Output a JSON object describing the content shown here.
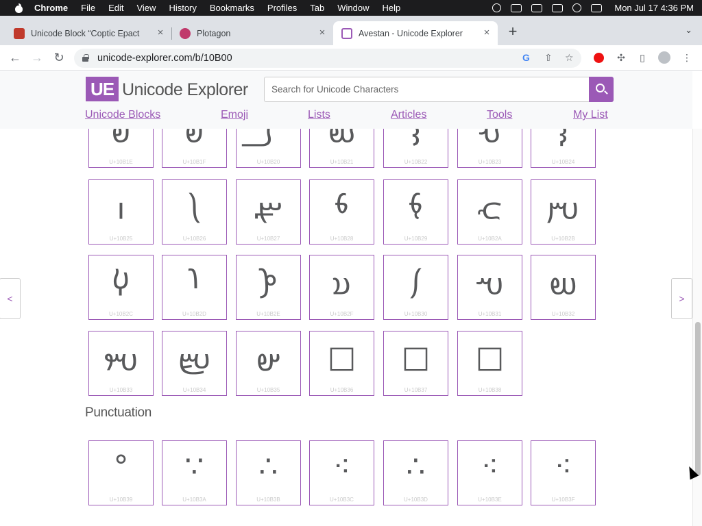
{
  "menubar": {
    "app_name": "Chrome",
    "items": [
      "File",
      "Edit",
      "View",
      "History",
      "Bookmarks",
      "Profiles",
      "Tab",
      "Window",
      "Help"
    ],
    "clock": "Mon Jul 17  4:36 PM"
  },
  "browser": {
    "tabs": [
      {
        "title": "Unicode Block “Coptic Epact N",
        "icon": "unicode-block-favicon",
        "active": false
      },
      {
        "title": "Plotagon",
        "icon": "plotagon-favicon",
        "active": false
      },
      {
        "title": "Avestan - Unicode Explorer",
        "icon": "unicode-explorer-favicon",
        "active": true
      }
    ],
    "url": "unicode-explorer.com/b/10B00"
  },
  "site": {
    "logo_mark": "UE",
    "logo_text": "Unicode Explorer",
    "search_placeholder": "Search for Unicode Characters",
    "nav": [
      "Unicode Blocks",
      "Emoji",
      "Lists",
      "Articles",
      "Tools",
      "My List"
    ],
    "prev_arrow": "<",
    "next_arrow": ">"
  },
  "grid": {
    "rows": [
      [
        {
          "glyph": "𐬞",
          "code": "U+10B1E"
        },
        {
          "glyph": "𐬟",
          "code": "U+10B1F"
        },
        {
          "glyph": "𐬠",
          "code": "U+10B20"
        },
        {
          "glyph": "𐬡",
          "code": "U+10B21"
        },
        {
          "glyph": "𐬢",
          "code": "U+10B22"
        },
        {
          "glyph": "𐬣",
          "code": "U+10B23"
        },
        {
          "glyph": "𐬤",
          "code": "U+10B24"
        }
      ],
      [
        {
          "glyph": "𐬥",
          "code": "U+10B25"
        },
        {
          "glyph": "𐬦",
          "code": "U+10B26"
        },
        {
          "glyph": "𐬧",
          "code": "U+10B27"
        },
        {
          "glyph": "𐬨",
          "code": "U+10B28"
        },
        {
          "glyph": "𐬩",
          "code": "U+10B29"
        },
        {
          "glyph": "𐬪",
          "code": "U+10B2A"
        },
        {
          "glyph": "𐬫",
          "code": "U+10B2B"
        }
      ],
      [
        {
          "glyph": "𐬬",
          "code": "U+10B2C"
        },
        {
          "glyph": "𐬭",
          "code": "U+10B2D"
        },
        {
          "glyph": "𐬮",
          "code": "U+10B2E"
        },
        {
          "glyph": "𐬯",
          "code": "U+10B2F"
        },
        {
          "glyph": "𐬰",
          "code": "U+10B30"
        },
        {
          "glyph": "𐬱",
          "code": "U+10B31"
        },
        {
          "glyph": "𐬲",
          "code": "U+10B32"
        }
      ],
      [
        {
          "glyph": "𐬳",
          "code": "U+10B33"
        },
        {
          "glyph": "𐬴",
          "code": "U+10B34"
        },
        {
          "glyph": "𐬵",
          "code": "U+10B35"
        },
        {
          "glyph": "□",
          "code": "U+10B36"
        },
        {
          "glyph": "□",
          "code": "U+10B37"
        },
        {
          "glyph": "□",
          "code": "U+10B38"
        }
      ]
    ],
    "section_title": "Punctuation",
    "punctuation": [
      {
        "glyph": "°",
        "code": "U+10B39"
      },
      {
        "glyph": "∵",
        "code": "U+10B3A"
      },
      {
        "glyph": "∴",
        "code": "U+10B3B"
      },
      {
        "glyph": "⁖",
        "code": "U+10B3C"
      },
      {
        "glyph": "∴",
        "code": "U+10B3D"
      },
      {
        "glyph": "⁖",
        "code": "U+10B3E"
      },
      {
        "glyph": "⁖",
        "code": "U+10B3F"
      }
    ]
  },
  "colors": {
    "brand": "#9b59b6",
    "glyph": "#58595b"
  }
}
